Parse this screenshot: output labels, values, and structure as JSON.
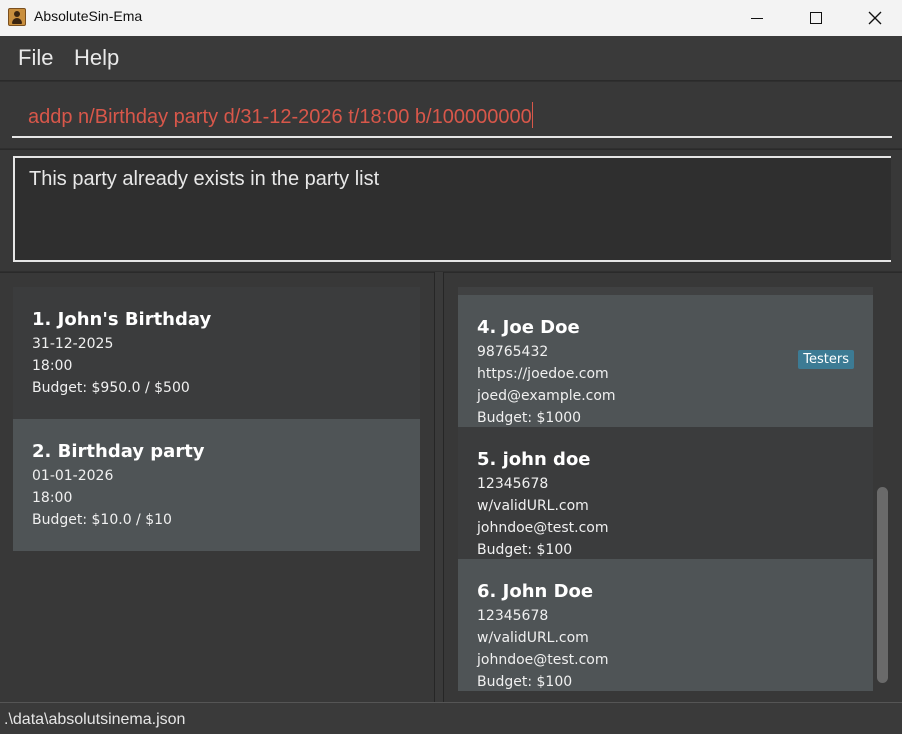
{
  "window": {
    "title": "AbsoluteSin-Ema",
    "controls": [
      "minimize-icon",
      "maximize-icon",
      "close-icon"
    ]
  },
  "menu": {
    "file": "File",
    "help": "Help"
  },
  "command": {
    "value": "addp n/Birthday party d/31-12-2026 t/18:00 b/100000000"
  },
  "result": {
    "message": "This party already exists in the party list"
  },
  "parties": [
    {
      "title": "1. John's Birthday",
      "date": "31-12-2025",
      "time": "18:00",
      "budget": "Budget: $950.0 / $500"
    },
    {
      "title": "2. Birthday party",
      "date": "01-01-2026",
      "time": "18:00",
      "budget": "Budget: $10.0 / $10"
    }
  ],
  "persons": [
    {
      "title": "4. Joe Doe",
      "phone": "98765432",
      "url": "https://joedoe.com",
      "email": "joed@example.com",
      "budget": "Budget: $1000",
      "tag": "Testers"
    },
    {
      "title": "5. john doe",
      "phone": "12345678",
      "url": "w/validURL.com",
      "email": "johndoe@test.com",
      "budget": "Budget: $100"
    },
    {
      "title": "6. John Doe",
      "phone": "12345678",
      "url": "w/validURL.com",
      "email": "johndoe@test.com",
      "budget": "Budget: $100"
    }
  ],
  "status": {
    "path": ".\\data\\absolutsinema.json"
  },
  "colors": {
    "command_text": "#d8574a",
    "tag_bg": "#3c7b94",
    "card_odd": "#3b3c3d",
    "card_even": "#4f5456"
  }
}
